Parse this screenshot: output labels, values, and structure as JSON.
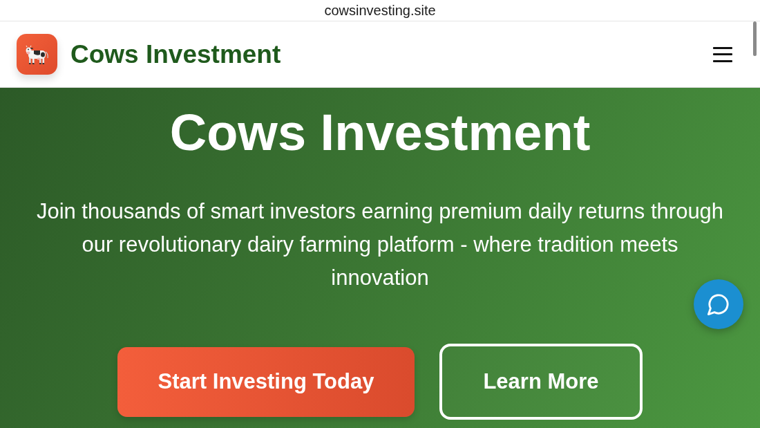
{
  "browser": {
    "address": "cowsinvesting.site"
  },
  "header": {
    "brand": "Cows Investment"
  },
  "hero": {
    "title": "Cows Investment",
    "subtitle": "Join thousands of smart investors earning premium daily returns through our revolutionary dairy farming platform - where tradition meets innovation",
    "buttons": [
      {
        "label": "Start Investing Today",
        "kind": "primary"
      },
      {
        "label": "Learn More",
        "kind": "outline"
      }
    ]
  }
}
